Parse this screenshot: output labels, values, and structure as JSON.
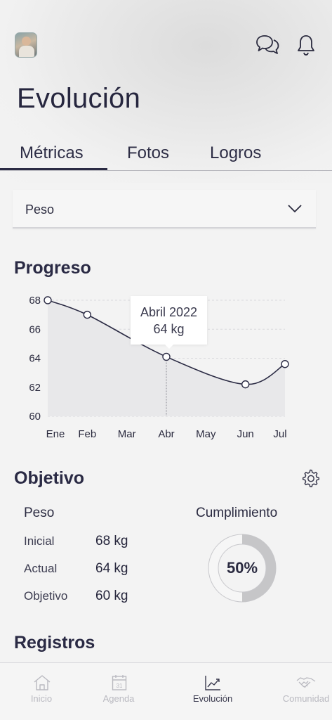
{
  "header": {
    "avatar_alt": "Foto de perfil",
    "title": "Evolución"
  },
  "tabs": [
    {
      "label": "Métricas",
      "active": true
    },
    {
      "label": "Fotos",
      "active": false
    },
    {
      "label": "Logros",
      "active": false
    }
  ],
  "metric_select": {
    "value": "Peso",
    "icon": "chevron-down-icon"
  },
  "progreso": {
    "title": "Progreso",
    "tooltip": {
      "line1": "Abril 2022",
      "line2": "64 kg"
    }
  },
  "chart_data": {
    "type": "line",
    "categories": [
      "Ene",
      "Feb",
      "Mar",
      "Abr",
      "May",
      "Jun",
      "Jul"
    ],
    "y_ticks": [
      "68",
      "66",
      "64",
      "62",
      "60"
    ],
    "ylim": [
      60,
      68
    ],
    "points": [
      {
        "x": "Ene",
        "y": 68.0
      },
      {
        "x": "Feb",
        "y": 67.0
      },
      {
        "x": "Abr",
        "y": 64.1
      },
      {
        "x": "Jun",
        "y": 62.2
      },
      {
        "x": "Jul",
        "y": 63.6
      }
    ],
    "highlight": "Abr",
    "grid": true,
    "line_color": "#2b2b44",
    "fill_color": "#e8e8ea"
  },
  "objetivo": {
    "title": "Objetivo",
    "metric": "Peso",
    "rows": [
      {
        "label": "Inicial",
        "value": "68 kg"
      },
      {
        "label": "Actual",
        "value": "64 kg"
      },
      {
        "label": "Objetivo",
        "value": "60 kg"
      }
    ],
    "cumplimiento_label": "Cumplimiento",
    "cumplimiento_pct": "50%",
    "cumplimiento_value": 0.5
  },
  "registros": {
    "title": "Registros"
  },
  "bottom_nav": [
    {
      "label": "Inicio",
      "icon": "home-icon",
      "active": false
    },
    {
      "label": "Agenda",
      "icon": "calendar-icon",
      "calendar_day": "31",
      "active": false
    },
    {
      "label": "Evolución",
      "icon": "trend-chart-icon",
      "active": true
    },
    {
      "label": "Comunidad",
      "icon": "handshake-icon",
      "active": false
    }
  ]
}
